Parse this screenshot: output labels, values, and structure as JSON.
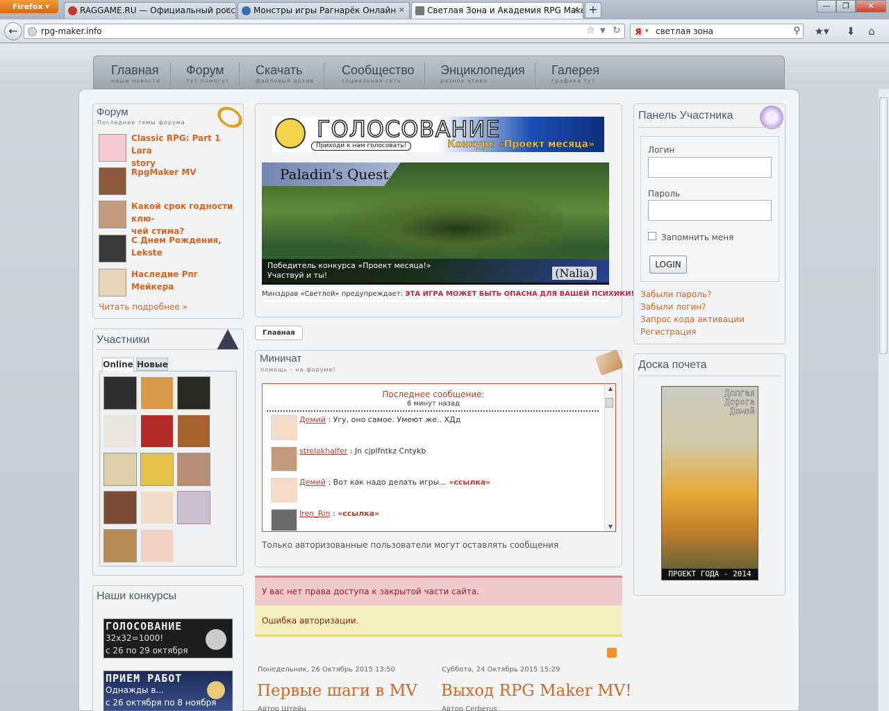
{
  "browser": {
    "menu_label": "Firefox",
    "tabs": [
      {
        "label": "RAGGAME.RU — Официальный росс...",
        "active": false
      },
      {
        "label": "Монстры игры Рагнарёк Онлайн",
        "active": false
      },
      {
        "label": "Светлая Зона и Академия RPG Maker ...",
        "active": true
      }
    ],
    "new_tab": "+",
    "url": "rpg-maker.info",
    "search_value": "светлая зона",
    "window_buttons": [
      "—",
      "❐",
      "✕"
    ]
  },
  "nav": [
    {
      "title": "Главная",
      "sub": "наши новости"
    },
    {
      "title": "Форум",
      "sub": "тут помогут"
    },
    {
      "title": "Скачать",
      "sub": "файловый архив"
    },
    {
      "title": "Сообщество",
      "sub": "социальная сеть"
    },
    {
      "title": "Энциклопедия",
      "sub": "разное чтиво"
    },
    {
      "title": "Галерея",
      "sub": "графика тут"
    }
  ],
  "forum": {
    "title": "Форум",
    "subtitle": "Последние темы форума",
    "topics": [
      {
        "line1": "Classic RPG: Part 1 Lara",
        "line2": "story"
      },
      {
        "line1": "RpgMaker MV",
        "line2": ""
      },
      {
        "line1": "Какой срок годности клю-",
        "line2": "чей стима?"
      },
      {
        "line1": "С Днем Рождения, Lekste",
        "line2": ""
      },
      {
        "line1": "Наследие Рпг Мейкера",
        "line2": ""
      }
    ],
    "more": "Читать подробнее »"
  },
  "members": {
    "title": "Участники",
    "tab_online": "Online",
    "tab_new": "Новые"
  },
  "contests": {
    "title": "Наши конкурсы",
    "banner1": {
      "head": "ГОЛОСОВАНИЕ",
      "line1": "32x32=1000!",
      "line2": "с 26 по 29 октября"
    },
    "banner2": {
      "head": "ПРИЕМ РАБОТ",
      "line1": "Однажды в...",
      "line2": "с 26 октября по 8 ноября"
    }
  },
  "vote_banner": {
    "title": "ГОЛОСОВАНИЕ",
    "bubble": "Приходи к нам голосовать!",
    "contest": "Конкурс «Проект месяца»"
  },
  "game_banner": {
    "name": "Paladin's Quest",
    "winner_line1": "Победитель конкурса «Проект месяца!»",
    "winner_line2": "Участвуй и ты!",
    "author": "(Nalia)",
    "warning_prefix": "Минздрав «Светлой» предупреждает: ",
    "warning_text": "ЭТА ИГРА МОЖЕТ БЫТЬ ОПАСНА ДЛЯ ВАШЕЙ ПСИХИКИ!"
  },
  "breadcrumb": "Главная",
  "chat": {
    "title": "Миничат",
    "subtitle": "помощь - на форуме!",
    "last_label": "Последнее сообщение:",
    "last_time": "6 минут назад",
    "messages": [
      {
        "user": "Демий",
        "text": " : Угу, оно самое. Умеют же.. ХДд",
        "link": ""
      },
      {
        "user": "strelokhalfer",
        "text": " : Jn cjplfntkz Cntykb",
        "link": ""
      },
      {
        "user": "Демий",
        "text": " : Вот как надо делать игры... ",
        "link": "«ссылка»"
      },
      {
        "user": "Iren_Rin",
        "text": " : ",
        "link": "«ссылка»"
      }
    ],
    "note": "Только авторизованные пользователи могут оставлять сообщения"
  },
  "alerts": {
    "error": "У вас нет права доступа к закрытой части сайта.",
    "warning": "Ошибка авторизации."
  },
  "news": [
    {
      "date": "Понедельник, 26 Октябрь 2015 13:50",
      "title": "Первые шаги в MV",
      "author": "Автор Штейн"
    },
    {
      "date": "Суббота, 24 Октябрь 2015 15:29",
      "title": "Выход RPG Maker MV!",
      "author": "Автор Cerberus"
    }
  ],
  "login": {
    "title": "Панель Участника",
    "login_label": "Логин",
    "password_label": "Пароль",
    "remember": "Запомнить меня",
    "button": "LOGIN",
    "links": [
      "Забыли пароль?",
      "Забыли логин?",
      "Запрос кода активации",
      "Регистрация"
    ]
  },
  "honor": {
    "title": "Доска почета",
    "poster_title": "Долгая Дорога Домой",
    "poster_caption": "ПРОЕКТ ГОДА - 2014"
  },
  "colors": {
    "accent": "#d7651f",
    "link_red": "#c0392b",
    "error_bg": "#f2c9cc",
    "warning_bg": "#f6efc0"
  }
}
